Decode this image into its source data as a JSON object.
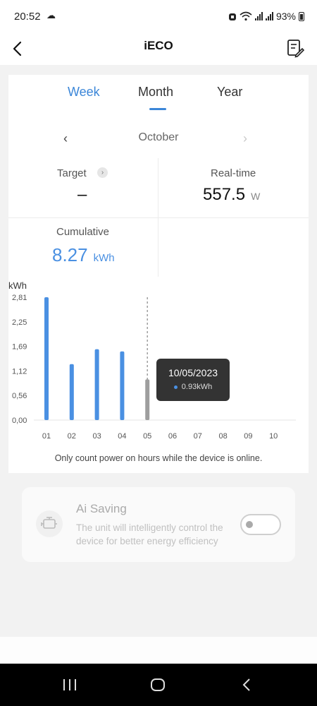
{
  "status": {
    "time": "20:52",
    "battery": "93%"
  },
  "header": {
    "title": "iECO"
  },
  "tabs": [
    {
      "label": "Week",
      "active": true
    },
    {
      "label": "Month",
      "active": false
    },
    {
      "label": "Year",
      "active": false
    }
  ],
  "month_nav": {
    "label": "October"
  },
  "stats": {
    "target_label": "Target",
    "target_value": "–",
    "realtime_label": "Real-time",
    "realtime_value": "557.5",
    "realtime_unit": "W",
    "cumulative_label": "Cumulative",
    "cumulative_value": "8.27",
    "cumulative_unit": "kWh"
  },
  "chart_data": {
    "type": "bar",
    "ylabel": "kWh",
    "yticks": [
      "2,81",
      "2,25",
      "1,69",
      "1,12",
      "0,56",
      "0,00"
    ],
    "ylim": [
      0,
      2.81
    ],
    "categories": [
      "01",
      "02",
      "03",
      "04",
      "05",
      "06",
      "07",
      "08",
      "09",
      "10"
    ],
    "values": [
      2.81,
      1.28,
      1.62,
      1.57,
      0.93,
      null,
      null,
      null,
      null,
      null
    ],
    "selected_index": 4,
    "tooltip": {
      "date": "10/05/2023",
      "value": "0.93kWh"
    },
    "colors": {
      "bar": "#4a90e2",
      "selected": "#9e9e9e"
    }
  },
  "footnote": "Only count power on hours while the device is online.",
  "ai_saving": {
    "title": "Ai Saving",
    "description": "The unit will intelligently control the device for better energy efficiency",
    "enabled": false
  }
}
